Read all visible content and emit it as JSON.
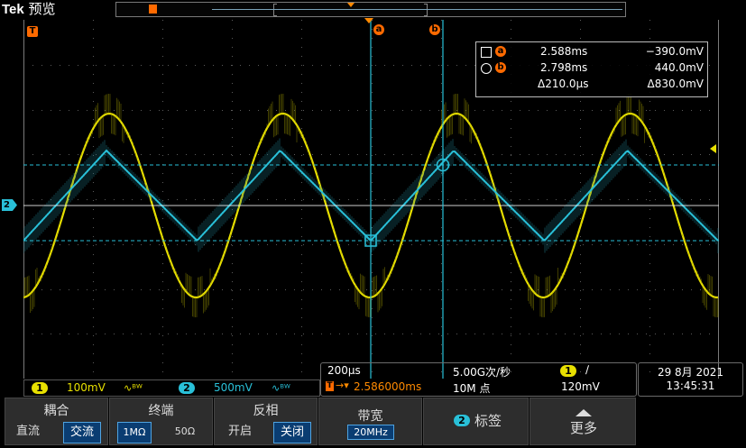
{
  "brand": {
    "logo": "Tek",
    "mode": "预览"
  },
  "markers": {
    "trigger_pos": "T",
    "cursor_a": "a",
    "cursor_b": "b",
    "ch2_level": "2"
  },
  "cursor_readout": {
    "a": {
      "time": "2.588ms",
      "voltage": "−390.0mV"
    },
    "b": {
      "time": "2.798ms",
      "voltage": "440.0mV"
    },
    "delta": {
      "time": "Δ210.0µs",
      "voltage": "Δ830.0mV"
    }
  },
  "channels": [
    {
      "num": "1",
      "scale": "100mV",
      "bw_icon": "∿ᴮᵂ",
      "color": "#e8e000"
    },
    {
      "num": "2",
      "scale": "500mV",
      "bw_icon": "∿ᴮᵂ",
      "color": "#29c0d8"
    }
  ],
  "horizontal": {
    "scale": "200µs",
    "sample_rate": "5.00G次/秒",
    "delay": "2.586000ms",
    "record_length": "10M 点",
    "trig_source": "1",
    "trig_slope": "∕",
    "trig_level": "120mV"
  },
  "datetime": {
    "date": "29 8月 2021",
    "time": "13:45:31"
  },
  "menu": {
    "coupling": {
      "title": "耦合",
      "opt1": "直流",
      "opt2": "交流"
    },
    "termination": {
      "title": "终端",
      "opt1": "1MΩ",
      "opt2": "50Ω"
    },
    "invert": {
      "title": "反相",
      "opt1": "开启",
      "opt2": "关闭"
    },
    "bandwidth": {
      "title": "带宽",
      "value": "20MHz"
    },
    "label": {
      "badge": "2",
      "text": "标签"
    },
    "more": {
      "text": "更多"
    }
  },
  "colors": {
    "ch1": "#e8e000",
    "ch2": "#29c0d8",
    "cursor": "#29c0d8",
    "marker": "#ff6a00"
  }
}
